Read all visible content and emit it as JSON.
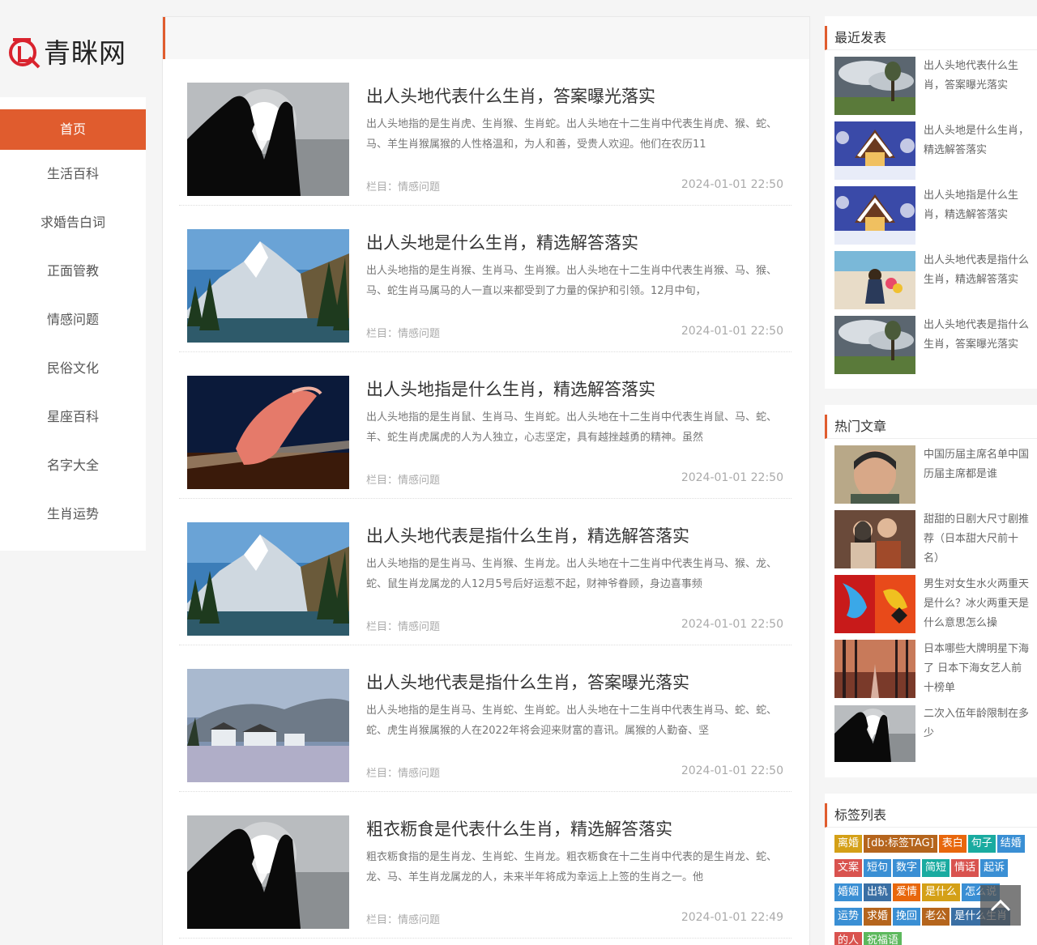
{
  "site": {
    "name": "青眯网"
  },
  "nav": {
    "items": [
      {
        "label": "首页",
        "active": true
      },
      {
        "label": "生活百科"
      },
      {
        "label": "求婚告白词"
      },
      {
        "label": "正面管教"
      },
      {
        "label": "情感问题"
      },
      {
        "label": "民俗文化"
      },
      {
        "label": "星座百科"
      },
      {
        "label": "名字大全"
      },
      {
        "label": "生肖运势"
      }
    ]
  },
  "articles": [
    {
      "title": "出人头地代表什么生肖，答案曝光落实",
      "summary": "出人头地指的是生肖虎、生肖猴、生肖蛇。出人头地在十二生肖中代表生肖虎、猴、蛇、马、羊生肖猴属猴的人性格温和，为人和善，受贵人欢迎。他们在农历11",
      "category": "栏目：情感问题",
      "date": "2024-01-01 22:50",
      "image": "heart-hands"
    },
    {
      "title": "出人头地是什么生肖，精选解答落实",
      "summary": "出人头地指的是生肖猴、生肖马、生肖猴。出人头地在十二生肖中代表生肖猴、马、猴、马、蛇生肖马属马的人一直以来都受到了力量的保护和引领。12月中旬，",
      "category": "栏目：情感问题",
      "date": "2024-01-01 22:50",
      "image": "mountain-lake"
    },
    {
      "title": "出人头地指是什么生肖，精选解答落实",
      "summary": "出人头地指的是生肖鼠、生肖马、生肖蛇。出人头地在十二生肖中代表生肖鼠、马、蛇、羊、蛇生肖虎属虎的人为人独立，心志坚定，具有越挫越勇的精神。虽然",
      "category": "栏目：情感问题",
      "date": "2024-01-01 22:50",
      "image": "piano-hand"
    },
    {
      "title": "出人头地代表是指什么生肖，精选解答落实",
      "summary": "出人头地指的是生肖马、生肖猴、生肖龙。出人头地在十二生肖中代表生肖马、猴、龙、蛇、鼠生肖龙属龙的人12月5号后好运惹不起，财神爷眷顾，身边喜事频",
      "category": "栏目：情感问题",
      "date": "2024-01-01 22:50",
      "image": "mountain-lake"
    },
    {
      "title": "出人头地代表是指什么生肖，答案曝光落实",
      "summary": "出人头地指的是生肖马、生肖蛇、生肖蛇。出人头地在十二生肖中代表生肖马、蛇、蛇、蛇、虎生肖猴属猴的人在2022年将会迎来财富的喜讯。属猴的人勤奋、坚",
      "category": "栏目：情感问题",
      "date": "2024-01-01 22:50",
      "image": "village-misty"
    },
    {
      "title": "粗衣粝食是代表什么生肖，精选解答落实",
      "summary": "粗衣粝食指的是生肖龙、生肖蛇、生肖龙。粗衣粝食在十二生肖中代表的是生肖龙、蛇、龙、马、羊生肖龙属龙的人，未来半年将成为幸运上上签的生肖之一。他",
      "category": "栏目：情感问题",
      "date": "2024-01-01 22:49",
      "image": "heart-hands"
    }
  ],
  "recent": {
    "title": "最近发表",
    "items": [
      {
        "text": "出人头地代表什么生肖，答案曝光落实",
        "image": "cloud-tree"
      },
      {
        "text": "出人头地是什么生肖，精选解答落实",
        "image": "snow-cabin"
      },
      {
        "text": "出人头地指是什么生肖，精选解答落实",
        "image": "snow-cabin"
      },
      {
        "text": "出人头地代表是指什么生肖，精选解答落实",
        "image": "beach-girl"
      },
      {
        "text": "出人头地代表是指什么生肖，答案曝光落实",
        "image": "cloud-tree"
      }
    ]
  },
  "hot": {
    "title": "热门文章",
    "items": [
      {
        "text": "中国历届主席名单中国历届主席都是谁",
        "image": "portrait"
      },
      {
        "text": "甜甜的日剧大尺寸剧推荐（日本甜大尺前十名）",
        "image": "couple"
      },
      {
        "text": "男生对女生水火两重天是什么？冰火两重天是什么意思怎么操",
        "image": "fire-ice"
      },
      {
        "text": "日本哪些大牌明星下海了 日本下海女艺人前十榜单",
        "image": "forest-road"
      },
      {
        "text": "二次入伍年龄限制在多少",
        "image": "heart-hands"
      }
    ]
  },
  "tagsWidget": {
    "title": "标签列表",
    "tags": [
      {
        "label": "离婚",
        "color": "#d4a017"
      },
      {
        "label": "[db:标签TAG]",
        "color": "#b5651d"
      },
      {
        "label": "表白",
        "color": "#e8670c"
      },
      {
        "label": "句子",
        "color": "#1aaba0"
      },
      {
        "label": "结婚",
        "color": "#3a8fd4"
      },
      {
        "label": "文案",
        "color": "#d9534f"
      },
      {
        "label": "短句",
        "color": "#3a8fd4"
      },
      {
        "label": "数字",
        "color": "#3a8fd4"
      },
      {
        "label": "简短",
        "color": "#1aaba0"
      },
      {
        "label": "情话",
        "color": "#d9534f"
      },
      {
        "label": "起诉",
        "color": "#3a8fd4"
      },
      {
        "label": "婚姻",
        "color": "#3a8fd4"
      },
      {
        "label": "出轨",
        "color": "#3a6fa4"
      },
      {
        "label": "爱情",
        "color": "#e8670c"
      },
      {
        "label": "是什么",
        "color": "#d4a017"
      },
      {
        "label": "怎么说",
        "color": "#3a8fd4"
      },
      {
        "label": "运势",
        "color": "#3a8fd4"
      },
      {
        "label": "求婚",
        "color": "#b5651d"
      },
      {
        "label": "挽回",
        "color": "#3a8fd4"
      },
      {
        "label": "老公",
        "color": "#b5651d"
      },
      {
        "label": "是什么生肖",
        "color": "#3a6fa4"
      },
      {
        "label": "的人",
        "color": "#d9534f"
      },
      {
        "label": "祝福语",
        "color": "#5cb85c"
      }
    ]
  },
  "colors": {
    "accent": "#e05c2e"
  }
}
